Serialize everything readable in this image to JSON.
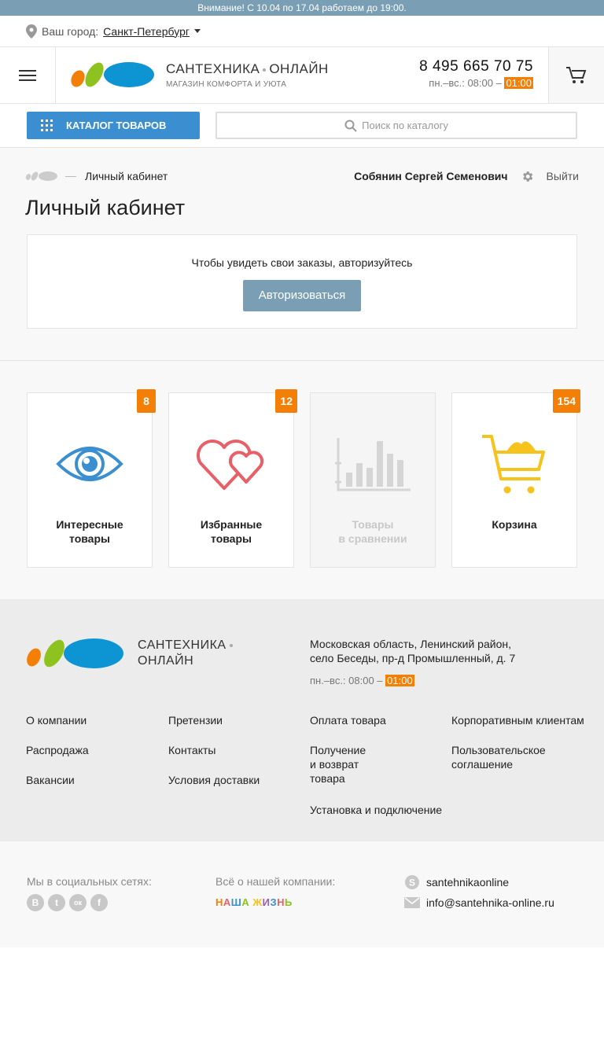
{
  "topbar": {
    "notice": "Внимание! С 10.04 по 17.04 работаем до 19:00."
  },
  "city": {
    "label": "Ваш город:",
    "value": "Санкт-Петербург"
  },
  "header": {
    "brand_name_left": "САНТЕХНИКА",
    "brand_name_right": "ОНЛАЙН",
    "brand_sub": "МАГАЗИН КОМФОРТА И УЮТА",
    "phone": "8 495 665 70 75",
    "hours_prefix": "пн.–вс.: 08:00 –",
    "hours_end": "01:00"
  },
  "search": {
    "catalog_label": "КАТАЛОГ ТОВАРОВ",
    "placeholder": "Поиск по каталогу"
  },
  "breadcrumb": {
    "current": "Личный кабинет"
  },
  "user": {
    "name": "Собянин Сергей Семенович",
    "logout": "Выйти"
  },
  "page": {
    "title": "Личный кабинет"
  },
  "auth": {
    "message": "Чтобы увидеть свои заказы, авторизуйтесь",
    "button": "Авторизоваться"
  },
  "cards": [
    {
      "label": "Интересные\nтовары",
      "badge": "8",
      "icon": "eye-icon"
    },
    {
      "label": "Избранные\nтовары",
      "badge": "12",
      "icon": "hearts-icon"
    },
    {
      "label": "Товары\nв сравнении",
      "badge": "",
      "icon": "bar-chart-icon"
    },
    {
      "label": "Корзина",
      "badge": "154",
      "icon": "cart-icon"
    }
  ],
  "footer": {
    "brand_line1": "САНТЕХНИКА",
    "brand_line2": "ОНЛАЙН",
    "address_line1": "Московская область, Ленинский район,",
    "address_line2": "село Беседы, пр-д Промышленный, д. 7",
    "hours_prefix": "пн.–вс.: 08:00 –",
    "hours_end": "01:00",
    "links": [
      "О компании",
      "Претензии",
      "Оплата товара",
      "Корпоративным клиентам",
      "Распродажа",
      "Контакты",
      "Получение\nи возврат товара",
      "Пользовательское\nсоглашение",
      "Вакансии",
      "Условия доставки",
      "Установка и подключение"
    ]
  },
  "bottom": {
    "social_label": "Мы в социальных сетях:",
    "social": [
      "В",
      "t",
      "ок",
      "f"
    ],
    "company_label": "Всё о нашей компании:",
    "nasha": "НАША ЖИЗНЬ",
    "skype": "santehnikaonline",
    "email": "info@santehnika-online.ru"
  },
  "colors": {
    "accent": "#3b8fd0",
    "orange": "#f47f06",
    "muted_blue": "#7a9fb4",
    "green": "#8dc21f"
  }
}
